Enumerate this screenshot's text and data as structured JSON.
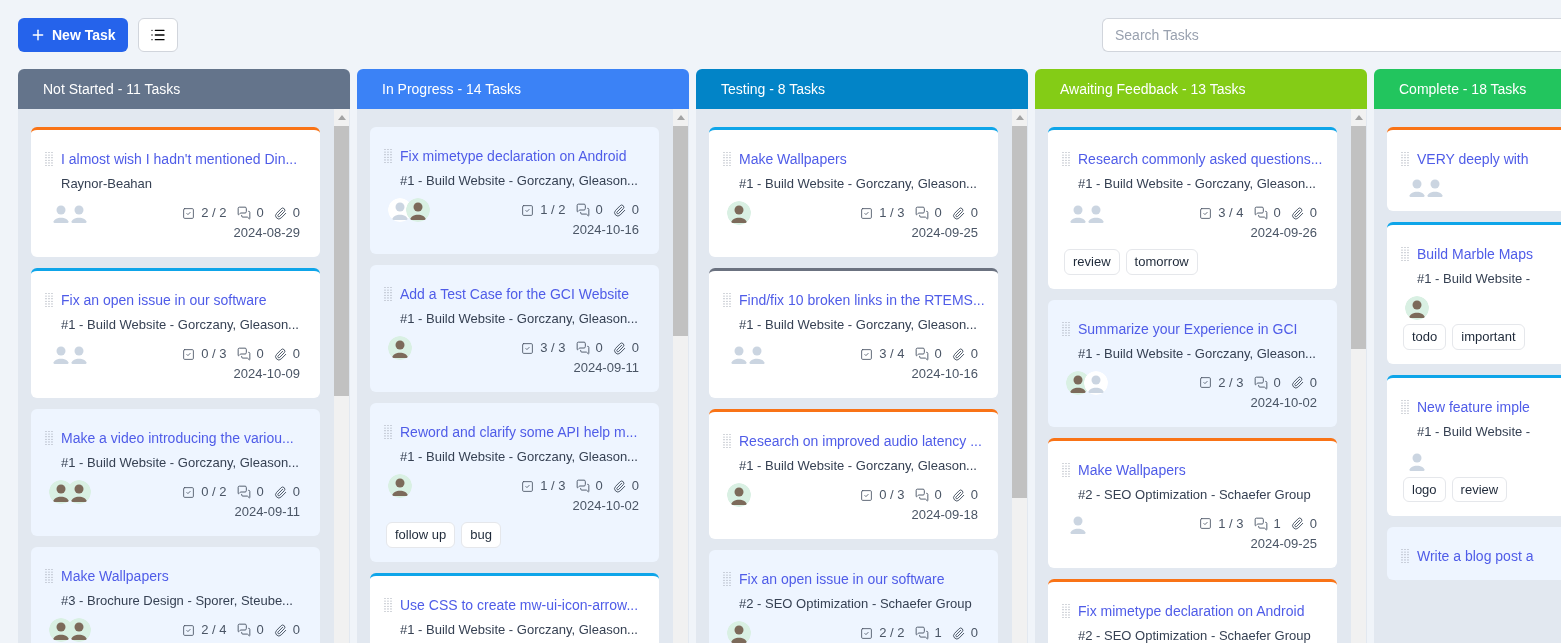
{
  "toolbar": {
    "new_task": "New Task",
    "search": {
      "placeholder": "Search Tasks"
    }
  },
  "columns": [
    {
      "title": "Not Started - 11 Tasks",
      "color": "#64748b",
      "cards": [
        {
          "title": "I almost wish I hadn't mentioned Din...",
          "subtitle": "Raynor-Beahan",
          "color": "#f97316",
          "highlighted": false,
          "avatars": [
            {
              "photo": false
            },
            {
              "photo": false
            }
          ],
          "checklist": "2 / 2",
          "comments": "0",
          "attachments": "0",
          "date": "2024-08-29"
        },
        {
          "title": "Fix an open issue in our software",
          "subtitle": "#1 - Build Website - Gorczany, Gleason...",
          "color": "#0ea5e9",
          "highlighted": false,
          "avatars": [
            {
              "photo": false
            },
            {
              "photo": false
            }
          ],
          "checklist": "0 / 3",
          "comments": "0",
          "attachments": "0",
          "date": "2024-10-09"
        },
        {
          "title": "Make a video introducing the variou...",
          "subtitle": "#1 - Build Website - Gorczany, Gleason...",
          "highlighted": true,
          "avatars": [
            {
              "photo": true
            },
            {
              "photo": true
            }
          ],
          "checklist": "0 / 2",
          "comments": "0",
          "attachments": "0",
          "date": "2024-09-11"
        },
        {
          "title": "Make Wallpapers",
          "subtitle": "#3 - Brochure Design - Sporer, Steube...",
          "highlighted": true,
          "avatars": [
            {
              "photo": true
            },
            {
              "photo": true
            }
          ],
          "checklist": "2 / 4",
          "comments": "0",
          "attachments": "0"
        }
      ]
    },
    {
      "title": "In Progress - 14 Tasks",
      "color": "#3b82f6",
      "cards": [
        {
          "title": "Fix mimetype declaration on Android",
          "subtitle": "#1 - Build Website - Gorczany, Gleason...",
          "highlighted": true,
          "avatars": [
            {
              "photo": false
            },
            {
              "photo": true
            }
          ],
          "checklist": "1 / 2",
          "comments": "0",
          "attachments": "0",
          "date": "2024-10-16"
        },
        {
          "title": "Add a Test Case for the GCI Website",
          "subtitle": "#1 - Build Website - Gorczany, Gleason...",
          "highlighted": true,
          "avatars": [
            {
              "photo": true
            }
          ],
          "checklist": "3 / 3",
          "comments": "0",
          "attachments": "0",
          "date": "2024-09-11"
        },
        {
          "title": "Reword and clarify some API help m...",
          "subtitle": "#1 - Build Website - Gorczany, Gleason...",
          "highlighted": true,
          "avatars": [
            {
              "photo": true
            }
          ],
          "checklist": "1 / 3",
          "comments": "0",
          "attachments": "0",
          "date": "2024-10-02",
          "tags": [
            "follow up",
            "bug"
          ]
        },
        {
          "title": "Use CSS to create mw-ui-icon-arrow...",
          "subtitle": "#1 - Build Website - Gorczany, Gleason...",
          "color": "#0ea5e9",
          "highlighted": false
        }
      ]
    },
    {
      "title": "Testing - 8 Tasks",
      "color": "#0284c7",
      "cards": [
        {
          "title": "Make Wallpapers",
          "subtitle": "#1 - Build Website - Gorczany, Gleason...",
          "color": "#0ea5e9",
          "highlighted": false,
          "avatars": [
            {
              "photo": true
            }
          ],
          "checklist": "1 / 3",
          "comments": "0",
          "attachments": "0",
          "date": "2024-09-25"
        },
        {
          "title": "Find/fix 10 broken links in the RTEMS...",
          "subtitle": "#1 - Build Website - Gorczany, Gleason...",
          "color": "#6b7280",
          "highlighted": false,
          "avatars": [
            {
              "photo": false
            },
            {
              "photo": false
            }
          ],
          "checklist": "3 / 4",
          "comments": "0",
          "attachments": "0",
          "date": "2024-10-16"
        },
        {
          "title": "Research on improved audio latency ...",
          "subtitle": "#1 - Build Website - Gorczany, Gleason...",
          "color": "#f97316",
          "highlighted": false,
          "avatars": [
            {
              "photo": true
            }
          ],
          "checklist": "0 / 3",
          "comments": "0",
          "attachments": "0",
          "date": "2024-09-18"
        },
        {
          "title": "Fix an open issue in our software",
          "subtitle": "#2 - SEO Optimization - Schaefer Group",
          "highlighted": true,
          "avatars": [
            {
              "photo": true
            }
          ],
          "checklist": "2 / 2",
          "comments": "1",
          "attachments": "0"
        }
      ]
    },
    {
      "title": "Awaiting Feedback - 13 Tasks",
      "color": "#84cc16",
      "cards": [
        {
          "title": "Research commonly asked questions...",
          "subtitle": "#1 - Build Website - Gorczany, Gleason...",
          "color": "#0ea5e9",
          "highlighted": false,
          "avatars": [
            {
              "photo": false
            },
            {
              "photo": false
            }
          ],
          "checklist": "3 / 4",
          "comments": "0",
          "attachments": "0",
          "date": "2024-09-26",
          "tags": [
            "review",
            "tomorrow"
          ]
        },
        {
          "title": "Summarize your Experience in GCI",
          "subtitle": "#1 - Build Website - Gorczany, Gleason...",
          "highlighted": true,
          "avatars": [
            {
              "photo": true
            },
            {
              "photo": false
            }
          ],
          "checklist": "2 / 3",
          "comments": "0",
          "attachments": "0",
          "date": "2024-10-02"
        },
        {
          "title": "Make Wallpapers",
          "subtitle": "#2 - SEO Optimization - Schaefer Group",
          "color": "#f97316",
          "highlighted": false,
          "avatars": [
            {
              "photo": false
            }
          ],
          "checklist": "1 / 3",
          "comments": "1",
          "attachments": "0",
          "date": "2024-09-25"
        },
        {
          "title": "Fix mimetype declaration on Android",
          "subtitle": "#2 - SEO Optimization - Schaefer Group",
          "color": "#f97316",
          "highlighted": false
        }
      ]
    },
    {
      "title": "Complete - 18 Tasks",
      "color": "#22c55e",
      "cards": [
        {
          "title": "VERY deeply with",
          "color": "#f97316",
          "highlighted": false,
          "avatars": [
            {
              "photo": false
            },
            {
              "photo": false
            }
          ]
        },
        {
          "title": "Build Marble Maps",
          "subtitle": "#1 - Build Website -",
          "color": "#0ea5e9",
          "highlighted": false,
          "avatars": [
            {
              "photo": true
            }
          ],
          "tags": [
            "todo",
            "important"
          ]
        },
        {
          "title": "New feature imple",
          "subtitle": "#1 - Build Website -",
          "color": "#0ea5e9",
          "highlighted": false,
          "avatars": [
            {
              "photo": false
            }
          ],
          "tags": [
            "logo",
            "review"
          ]
        },
        {
          "title": "Write a blog post a",
          "highlighted": true
        }
      ]
    }
  ]
}
